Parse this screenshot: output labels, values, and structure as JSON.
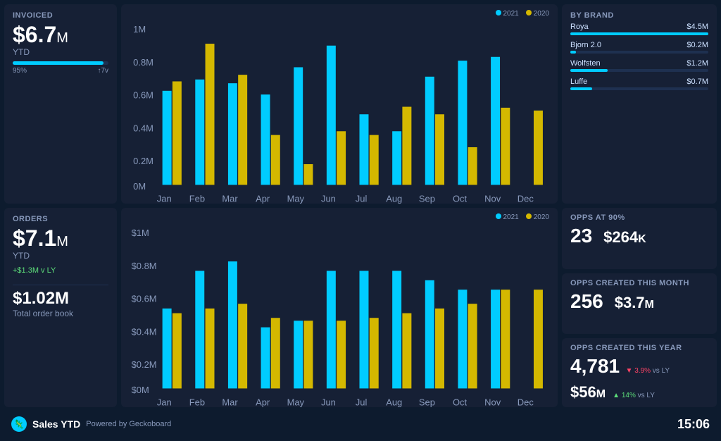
{
  "invoiced": {
    "title": "Invoiced",
    "value": "$6.7",
    "unit": "M",
    "label": "YTD",
    "progress": 95,
    "progress_label": "95%",
    "progress_target": "↑7v"
  },
  "invoiced_chart": {
    "legend_2021": "2021",
    "legend_2020": "2020",
    "y_labels": [
      "1M",
      "0.8M",
      "0.6M",
      "0.4M",
      "0.2M",
      "0M"
    ],
    "months": [
      "Jan",
      "Feb",
      "Mar",
      "Apr",
      "May",
      "Jun",
      "Jul",
      "Aug",
      "Sep",
      "Oct",
      "Nov",
      "Dec"
    ],
    "data_2021": [
      0.55,
      0.62,
      0.6,
      0.52,
      0.68,
      0.78,
      0.42,
      0.32,
      0.62,
      0.73,
      0.76,
      0.0
    ],
    "data_2020": [
      0.6,
      0.8,
      0.62,
      0.28,
      0.12,
      0.3,
      0.28,
      0.45,
      0.4,
      0.22,
      0.45,
      0.42
    ]
  },
  "brands": {
    "title": "By brand",
    "items": [
      {
        "name": "Roya",
        "value": "$4.5M",
        "pct": 100
      },
      {
        "name": "Bjorn 2.0",
        "value": "$0.2M",
        "pct": 4
      },
      {
        "name": "Wolfsten",
        "value": "$1.2M",
        "pct": 27
      },
      {
        "name": "Luffe",
        "value": "$0.7M",
        "pct": 16
      }
    ]
  },
  "orders": {
    "title": "Orders",
    "value": "$7.1",
    "unit": "M",
    "label": "YTD",
    "change": "+$1.3M v LY",
    "book_label": "Total order book",
    "book_value": "$1.02M"
  },
  "orders_chart": {
    "legend_2021": "2021",
    "legend_2020": "2020",
    "y_labels": [
      "$1M",
      "$0.8M",
      "$0.6M",
      "$0.4M",
      "$0.2M",
      "$0M"
    ],
    "months": [
      "Jan",
      "Feb",
      "Mar",
      "Apr",
      "May",
      "Jun",
      "Jul",
      "Aug",
      "Sep",
      "Oct",
      "Nov",
      "Dec"
    ],
    "data_2021": [
      0.48,
      0.7,
      0.75,
      0.34,
      0.38,
      0.72,
      0.72,
      0.72,
      0.65,
      0.6,
      0.6,
      0.0
    ],
    "data_2020": [
      0.45,
      0.48,
      0.5,
      0.42,
      0.38,
      0.38,
      0.42,
      0.45,
      0.48,
      0.5,
      0.6,
      0.6
    ]
  },
  "opps_90": {
    "title": "Opps at 90%",
    "count": "23",
    "amount": "$264",
    "amount_unit": "K"
  },
  "opps_month": {
    "title": "Opps created this month",
    "count": "256",
    "amount": "$3.7",
    "amount_unit": "M"
  },
  "opps_year": {
    "title": "Opps created this year",
    "count": "4,781",
    "change_count": "3.9%",
    "change_count_dir": "down",
    "change_count_label": "vs LY",
    "amount": "$56",
    "amount_unit": "M",
    "change_amount": "14%",
    "change_amount_dir": "up",
    "change_amount_label": "vs LY"
  },
  "footer": {
    "title": "Sales YTD",
    "powered": "Powered by Geckoboard",
    "time": "15:06"
  }
}
